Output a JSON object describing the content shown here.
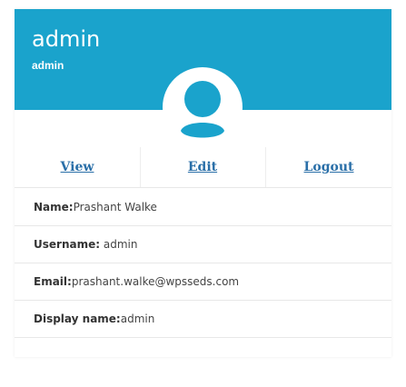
{
  "profile": {
    "display_title": "admin",
    "role": "admin",
    "avatar": "user-avatar-icon"
  },
  "nav": {
    "view": "View",
    "edit": "Edit",
    "logout": "Logout"
  },
  "fields": {
    "name_label": "Name:",
    "name_value": "Prashant Walke",
    "username_label": "Username:",
    "username_value": " admin",
    "email_label": "Email:",
    "email_value": "prashant.walke@wpsseds.com",
    "display_name_label": "Display name:",
    "display_name_value": "admin"
  },
  "colors": {
    "banner": "#1aa3cc",
    "link": "#2a6fa8",
    "avatar": "#1aa3cc"
  }
}
